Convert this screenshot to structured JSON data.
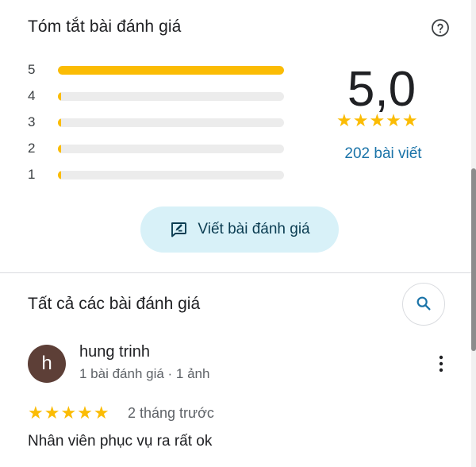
{
  "summary": {
    "title": "Tóm tắt bài đánh giá",
    "bars": [
      {
        "label": "5",
        "fraction": 1.0
      },
      {
        "label": "4",
        "fraction": 0.012
      },
      {
        "label": "3",
        "fraction": 0.012
      },
      {
        "label": "2",
        "fraction": 0.012
      },
      {
        "label": "1",
        "fraction": 0.012
      }
    ],
    "rating": "5,0",
    "stars": "★★★★★",
    "review_count": "202 bài viết",
    "write_button_label": "Viết bài đánh giá"
  },
  "all_reviews": {
    "title": "Tất cả các bài đánh giá"
  },
  "review": {
    "avatar_letter": "h",
    "name": "hung trinh",
    "meta": "1 bài đánh giá · 1 ảnh",
    "stars": "★★★★★",
    "time": "2 tháng trước",
    "text": "Nhân viên phục vụ ra rất ok"
  },
  "colors": {
    "star": "#fbbc04",
    "link": "#1a73a8",
    "button_bg": "#d8f1f8",
    "avatar_bg": "#5d3f37"
  }
}
